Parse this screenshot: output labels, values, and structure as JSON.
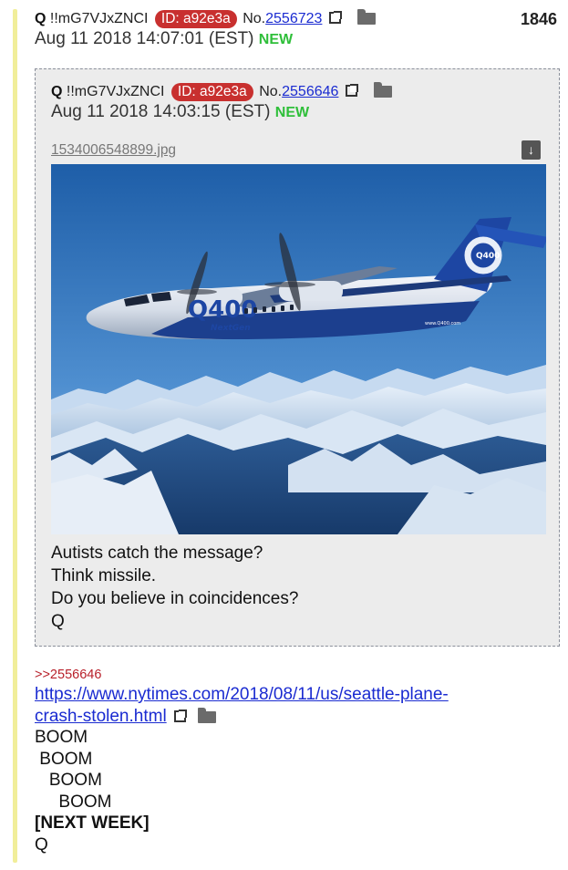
{
  "post": {
    "name": "Q",
    "tripcode": "!!mG7VJxZNCI",
    "id_badge": "ID: a92e3a",
    "no_prefix": "No.",
    "post_number": "2556723",
    "reply_count": "1846",
    "date": "Aug 11 2018 14:07:01 (EST)",
    "new_label": "NEW"
  },
  "quoted_post": {
    "name": "Q",
    "tripcode": "!!mG7VJxZNCI",
    "id_badge": "ID: a92e3a",
    "no_prefix": "No.",
    "post_number": "2556646",
    "date": "Aug 11 2018 14:03:15 (EST)",
    "new_label": "NEW",
    "filename": "1534006548899.jpg",
    "photo_text": {
      "tail_logo": "Q400",
      "fuselage_logo": "Q400",
      "fuselage_sub": "NextGen",
      "fuselage_small": "www.Q400.com"
    },
    "lines": [
      "Autists catch the message?",
      "Think missile.",
      "Do you believe in coincidences?",
      "Q"
    ]
  },
  "reply": {
    "ref": ">>2556646",
    "url_line1": "https://www.nytimes.com/2018/08/11/us/seattle-plane-",
    "url_line2": "crash-stolen.html",
    "boom1": "BOOM",
    "boom2": " BOOM",
    "boom3": "   BOOM",
    "boom4": "     BOOM",
    "next_week": "[NEXT WEEK]",
    "signoff": "Q"
  },
  "colors": {
    "id_badge": "#c8302f",
    "link": "#1a2bd1",
    "new": "#2fbf3a",
    "reply_ref": "#b8202a",
    "accent_bar": "#f1ee9a",
    "quoted_bg": "#ececec"
  },
  "icons": [
    "external-link-icon",
    "folder-icon",
    "download-icon"
  ]
}
